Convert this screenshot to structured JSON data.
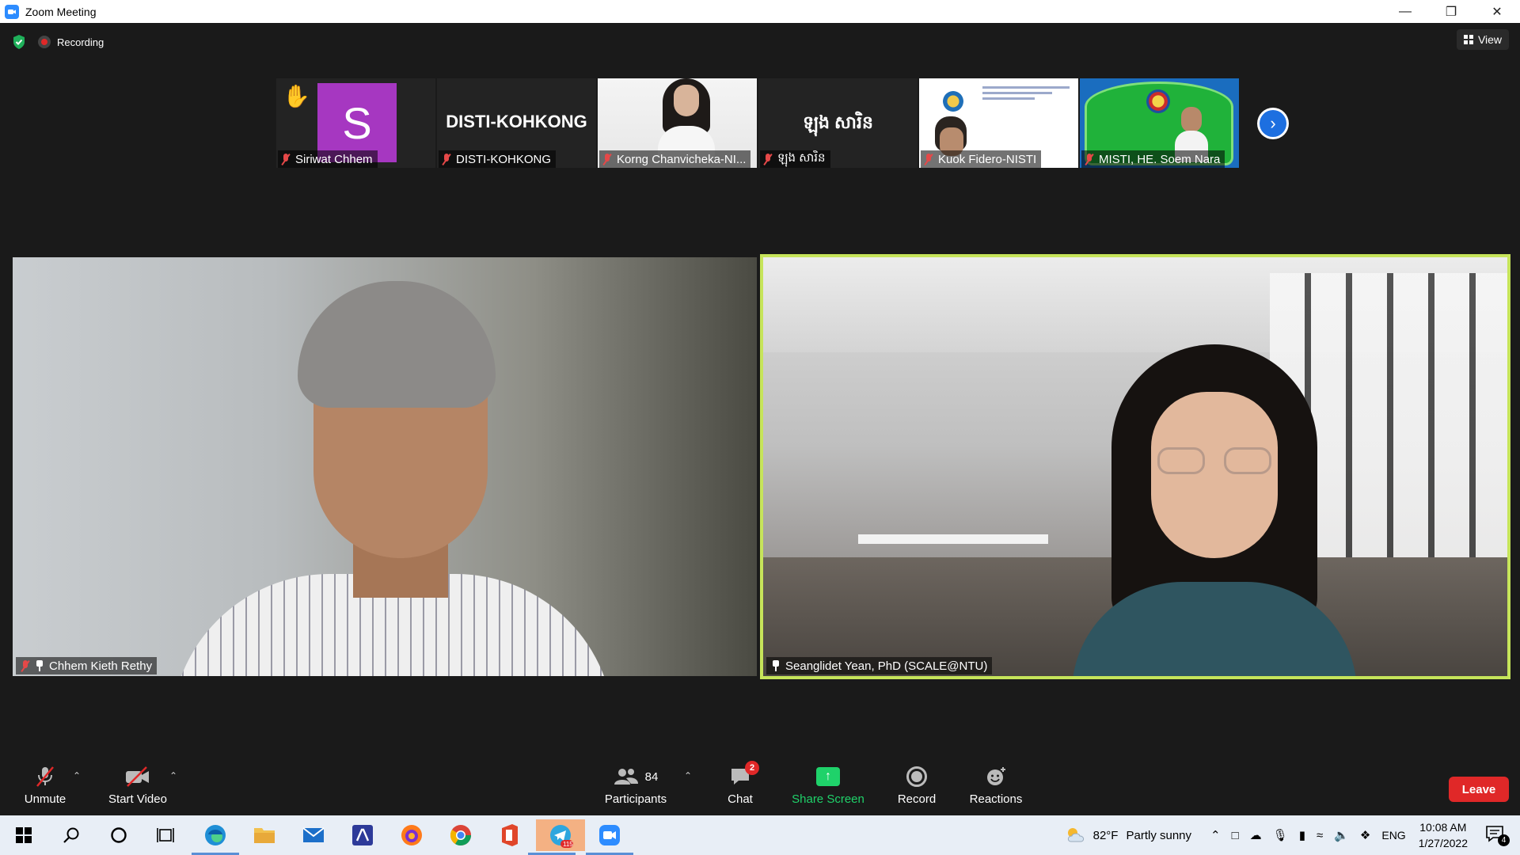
{
  "window": {
    "title": "Zoom Meeting"
  },
  "topbar": {
    "recording_label": "Recording",
    "view_label": "View"
  },
  "filmstrip": [
    {
      "name": "Siriwat Chhem",
      "avatar_letter": "S",
      "avatar_color": "#a637c1",
      "raised_hand": true
    },
    {
      "name": "DISTI-KOHKONG",
      "display_text": "DISTI-KOHKONG"
    },
    {
      "name": "Korng Chanvicheka-NI..."
    },
    {
      "name": "ឡុង សារិន",
      "display_text": "ឡុង សារិន"
    },
    {
      "name": "Kuok Fidero-NISTI"
    },
    {
      "name": "MISTI, HE. Soem Nara"
    }
  ],
  "main_videos": {
    "left": {
      "name": "Chhem Kieth Rethy"
    },
    "right": {
      "name": "Seanglidet Yean, PhD (SCALE@NTU)",
      "active_speaker_color": "#c6e45a"
    }
  },
  "toolbar": {
    "unmute_label": "Unmute",
    "start_video_label": "Start Video",
    "participants_label": "Participants",
    "participants_count": "84",
    "chat_label": "Chat",
    "chat_badge": "2",
    "share_screen_label": "Share Screen",
    "record_label": "Record",
    "reactions_label": "Reactions",
    "leave_label": "Leave"
  },
  "taskbar": {
    "weather_temp": "82°F",
    "weather_desc": "Partly sunny",
    "language": "ENG",
    "time": "10:08 AM",
    "date": "1/27/2022",
    "telegram_badge": "115",
    "notification_count": "4"
  }
}
